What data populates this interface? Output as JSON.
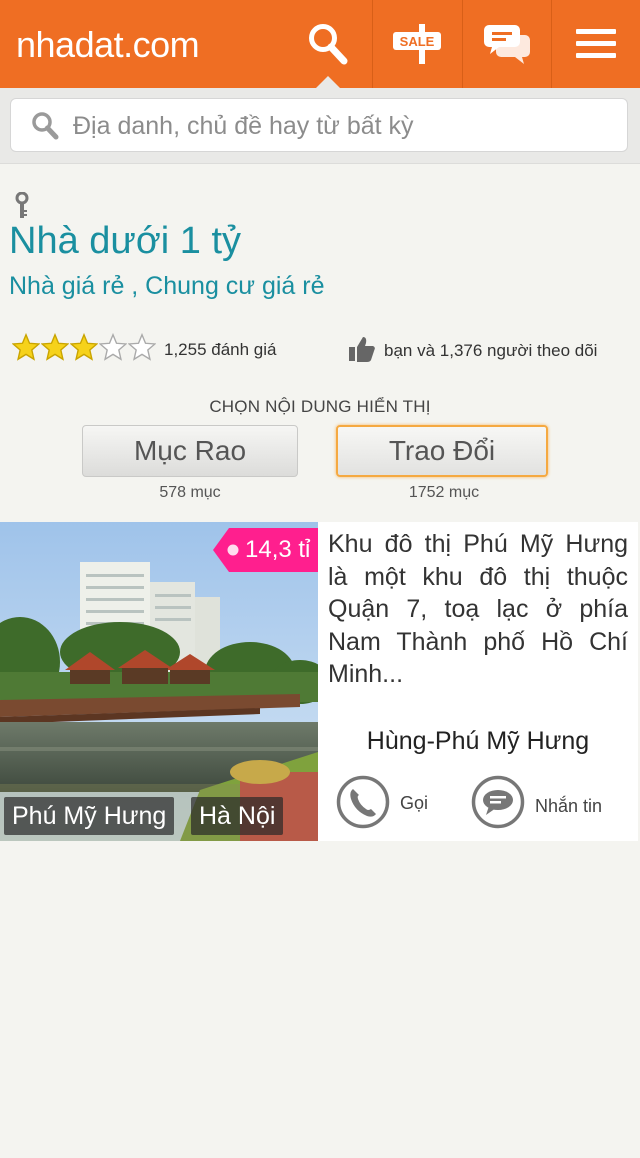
{
  "header": {
    "logo": "nhadat.com",
    "sale_badge": "SALE"
  },
  "search": {
    "placeholder": "Địa danh, chủ đề hay từ bất kỳ"
  },
  "topic": {
    "title": "Nhà dưới 1 tỷ",
    "subtitle": "Nhà giá rẻ , Chung cư giá rẻ",
    "rating_stars": 3,
    "rating_max": 5,
    "rating_text": "1,255 đánh giá",
    "follow_text": "bạn và 1,376 người theo dõi"
  },
  "content_selector": {
    "heading": "CHỌN NỘI DUNG HIỂN THỊ",
    "tabs": [
      {
        "label": "Mục Rao",
        "count": "578 mục",
        "active": false
      },
      {
        "label": "Trao Đổi",
        "count": "1752 mục",
        "active": true
      }
    ]
  },
  "listings": [
    {
      "price": "14,3 tỉ",
      "locations": [
        "Phú Mỹ Hưng",
        "Hà Nội"
      ],
      "description": "Khu đô thị Phú Mỹ Hưng là một khu đô thị thuộc Quận 7, toạ lạc ở phía Nam Thành phố Hồ Chí Minh...",
      "seller": "Hùng-Phú Mỹ Hưng",
      "call_label": "Gọi",
      "message_label": "Nhắn tin"
    }
  ],
  "colors": {
    "brand": "#ef6e23",
    "link": "#1a8fa0",
    "price_tag": "#ff1f8e",
    "active_tab_border": "#f5a941"
  }
}
